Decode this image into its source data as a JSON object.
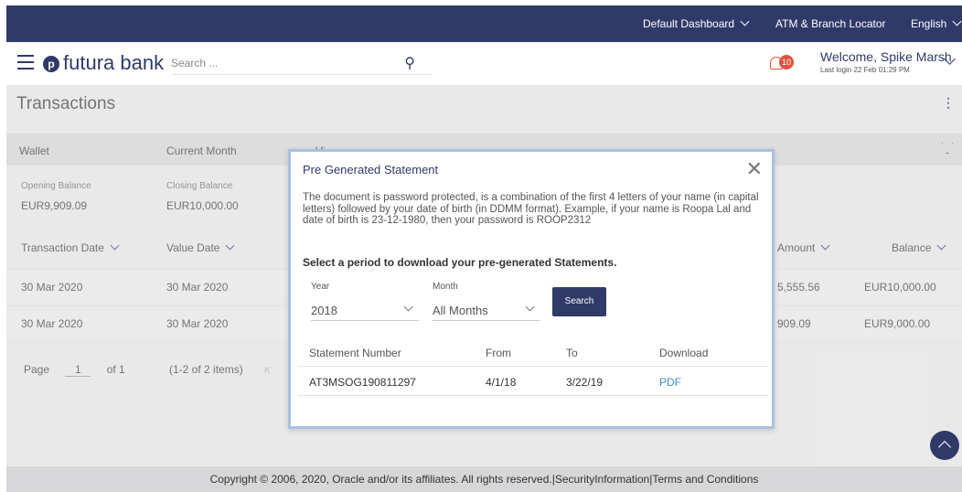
{
  "topbar": {
    "dashboard": "Default Dashboard",
    "locator": "ATM & Branch Locator",
    "language": "English"
  },
  "header": {
    "logo_mark": "p",
    "logo_text": "futura bank",
    "search_placeholder": "Search ...",
    "notification_count": "10",
    "welcome": "Welcome, Spike Marsh",
    "last_login": "Last login 22 Feb 01:29 PM"
  },
  "page": {
    "title": "Transactions",
    "filters": {
      "account": "Wallet",
      "period": "Current Month",
      "hidden": "Vi..."
    },
    "opening_label": "Opening Balance",
    "opening_value": "EUR9,909.09",
    "closing_label": "Closing Balance",
    "closing_value": "EUR10,000.00",
    "columns": {
      "txn_date": "Transaction Date",
      "value_date": "Value Date",
      "amount": "Amount",
      "balance": "Balance"
    },
    "rows": [
      {
        "txn_date": "30 Mar 2020",
        "value_date": "30 Mar 2020",
        "amount": "5,555.56",
        "balance": "EUR10,000.00"
      },
      {
        "txn_date": "30 Mar 2020",
        "value_date": "30 Mar 2020",
        "amount": "909.09",
        "balance": "EUR9,000.00"
      }
    ],
    "pager": {
      "page_label": "Page",
      "page_value": "1",
      "of_label": "of 1",
      "items": "(1-2 of 2 items)",
      "first": "K"
    }
  },
  "modal": {
    "title": "Pre Generated Statement",
    "description": "The document is password protected, is a combination of the first 4 letters of your name (in capital letters) followed by your date of birth (in DDMM format). Example, if your name is Roopa Lal and date of birth is 23-12-1980, then your password is ROOP2312",
    "lead": "Select a period to download your pre-generated Statements.",
    "year_label": "Year",
    "year_value": "2018",
    "month_label": "Month",
    "month_value": "All Months",
    "search_button": "Search",
    "table": {
      "headers": [
        "Statement Number",
        "From",
        "To",
        "Download"
      ],
      "rows": [
        {
          "number": "AT3MSOG190811297",
          "from": "4/1/18",
          "to": "3/22/19",
          "download": "PDF"
        }
      ]
    }
  },
  "footer": {
    "text": "Copyright © 2006, 2020, Oracle and/or its affiliates. All rights reserved.|SecurityInformation|Terms and Conditions"
  },
  "colors": {
    "brand": "#2f3a68",
    "accent": "#e0533d",
    "link": "#3b8ed2"
  }
}
